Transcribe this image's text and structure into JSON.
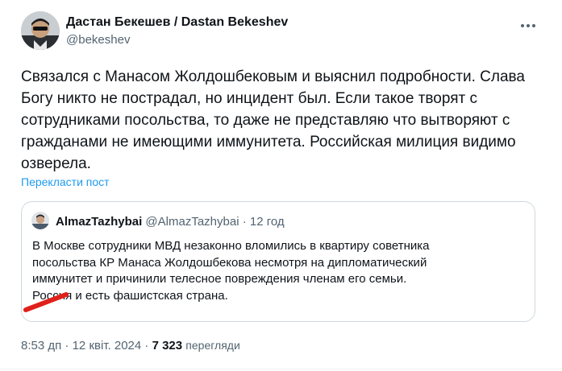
{
  "author": {
    "display_name": "Дастан Бекешев / Dastan Bekeshev",
    "handle": "@bekeshev"
  },
  "tweet": {
    "text": "Связался с Манасом Жолдошбековым и выяснил подробности. Слава\nБогу никто не пострадал, но инцидент был. Если такое творят с\nсотрудниками посольства, то даже не представляю что вытворяют с\nгражданами не имеющими иммунитета. Российская милиция видимо\nозверела.",
    "translate_label": "Перекласти пост"
  },
  "quote": {
    "name": "AlmazTazhybai",
    "handle": "@AlmazTazhybai",
    "separator": "·",
    "time": "12 год",
    "text": "В Москве сотрудники МВД незаконно вломились в квартиру советника\nпосольства КР Манаса Жолдошбекова несмотря на дипломатический\nиммунитет и причинили телесное повреждения членам его семьи.\nРоссия и есть фашистская страна."
  },
  "meta": {
    "time": "8:53 дп",
    "separator1": "·",
    "date": "12 квіт. 2024",
    "separator2": "·",
    "views_count": "7 323",
    "views_label": "перегляди"
  },
  "colors": {
    "text_primary": "#0f1419",
    "text_secondary": "#536471",
    "link": "#1d9bf0",
    "border": "#cfd9de",
    "annotation_red": "#e0201b"
  },
  "icons": {
    "more": "more-horizontal-icon"
  }
}
